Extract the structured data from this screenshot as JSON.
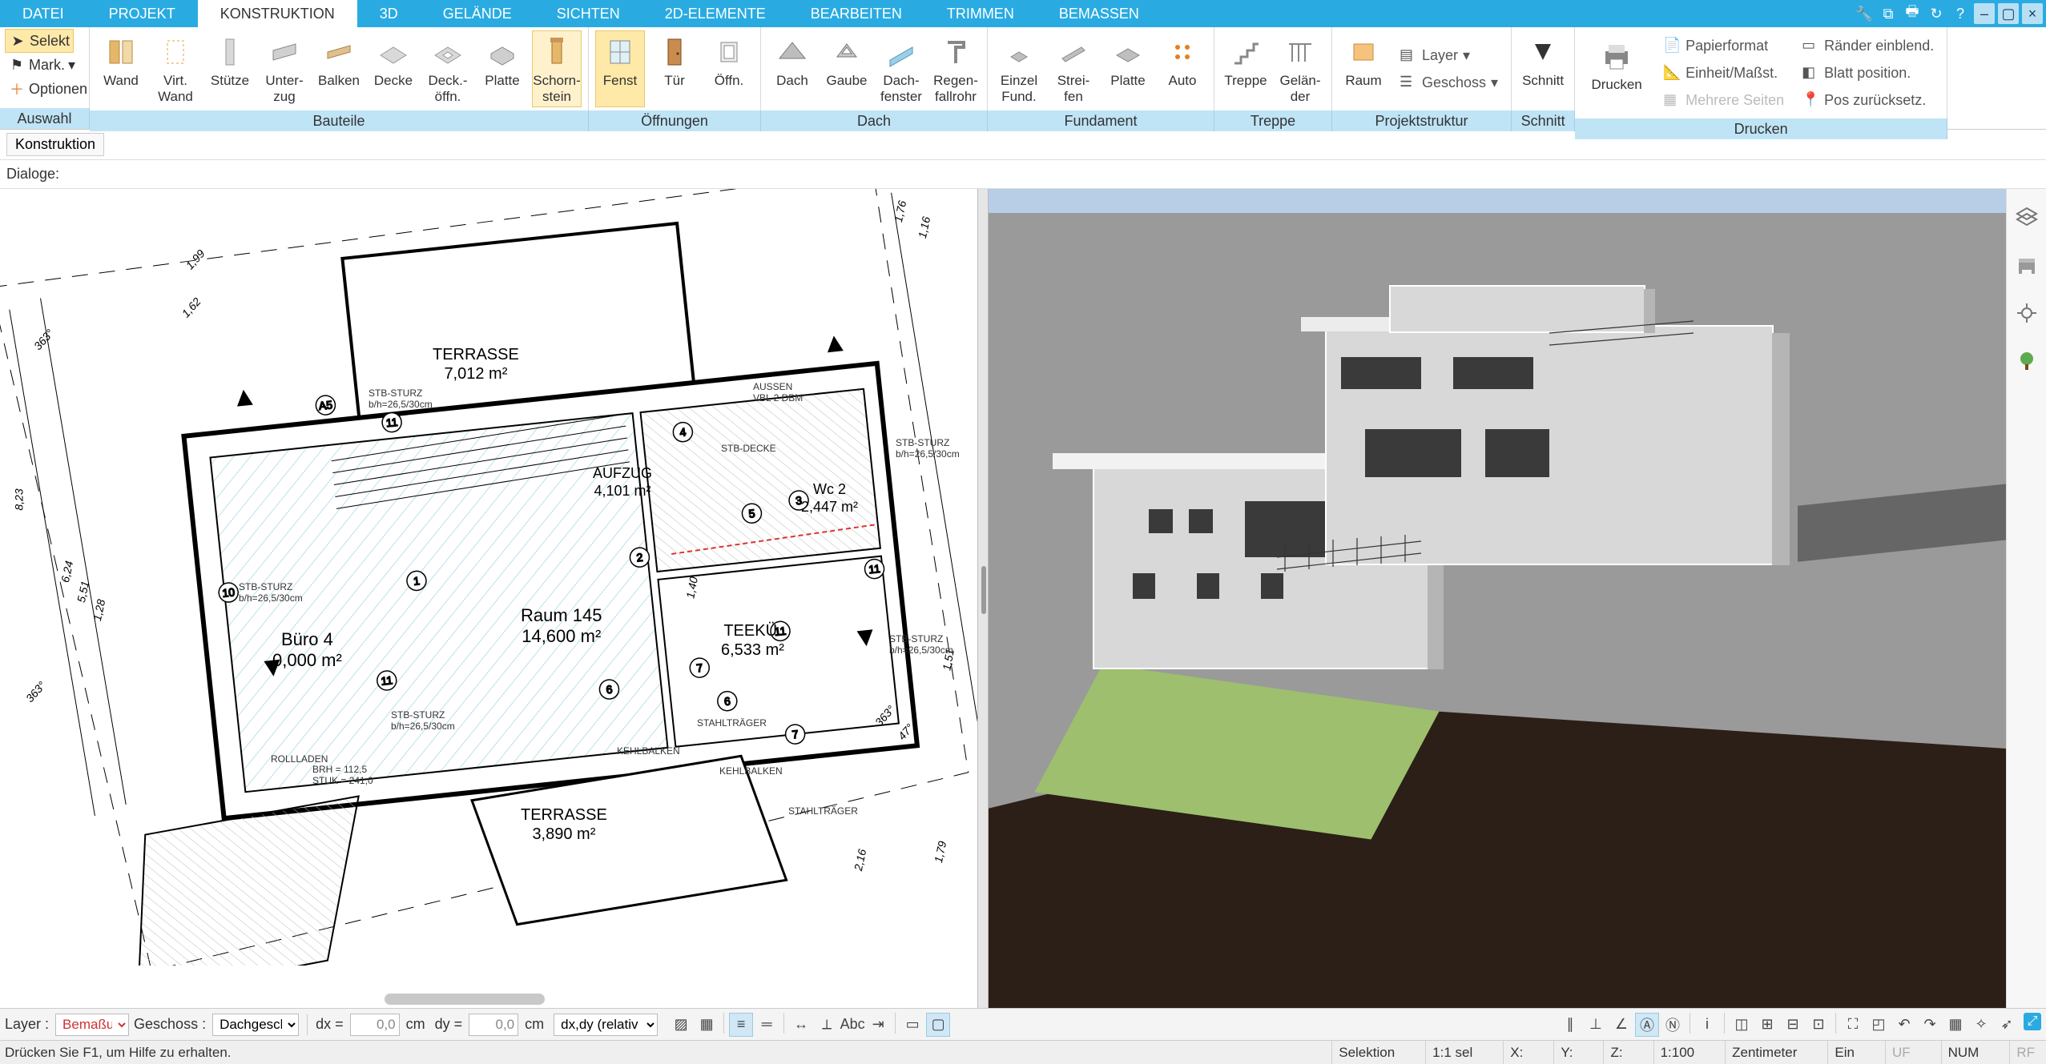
{
  "menu": {
    "tabs": [
      "DATEI",
      "PROJEKT",
      "KONSTRUKTION",
      "3D",
      "GELÄNDE",
      "SICHTEN",
      "2D-ELEMENTE",
      "BEARBEITEN",
      "TRIMMEN",
      "BEMASSEN"
    ],
    "active_index": 2
  },
  "ribbon": {
    "auswahl": {
      "foot": "Auswahl",
      "selekt": "Selekt",
      "mark": "Mark.",
      "optionen": "Optionen"
    },
    "bauteile": {
      "foot": "Bauteile",
      "items": [
        "Wand",
        "Virt.\nWand",
        "Stütze",
        "Unter-\nzug",
        "Balken",
        "Decke",
        "Deck.-\nöffn.",
        "Platte",
        "Schorn-\nstein"
      ]
    },
    "oeffnungen": {
      "foot": "Öffnungen",
      "items": [
        "Fenst",
        "Tür",
        "Öffn."
      ]
    },
    "dach": {
      "foot": "Dach",
      "items": [
        "Dach",
        "Gaube",
        "Dach-\nfenster",
        "Regen-\nfallrohr"
      ]
    },
    "fundament": {
      "foot": "Fundament",
      "items": [
        "Einzel\nFund.",
        "Strei-\nfen",
        "Platte",
        "Auto"
      ]
    },
    "treppe": {
      "foot": "Treppe",
      "items": [
        "Treppe",
        "Gelän-\nder"
      ]
    },
    "projektstruktur": {
      "foot": "Projektstruktur",
      "raum": "Raum",
      "layer": "Layer",
      "geschoss": "Geschoss"
    },
    "schnitt": {
      "foot": "Schnitt",
      "schnitt": "Schnitt"
    },
    "drucken": {
      "foot": "Drucken",
      "drucken": "Drucken",
      "links": [
        "Papierformat",
        "Einheit/Maßst.",
        "Mehrere Seiten",
        "Ränder einblend.",
        "Blatt position.",
        "Pos zurücksetz."
      ]
    }
  },
  "below": {
    "construction": "Konstruktion",
    "dialogs": "Dialoge:"
  },
  "plan": {
    "terrasse1": "TERRASSE",
    "terrasse1_area": "7,012 m²",
    "aufzug": "AUFZUG",
    "aufzug_area": "4,101 m²",
    "wc": "Wc 2",
    "wc_area": "2,447 m²",
    "buero": "Büro 4",
    "buero_area": "0,000 m²",
    "raum": "Raum 145",
    "raum_area": "14,600 m²",
    "teeku": "TEEKÜ.",
    "teeku_area": "6,533 m²",
    "terrasse2": "TERRASSE",
    "terrasse2_area": "3,890 m²",
    "dims": {
      "d199": "1,99",
      "d162": "1,62",
      "d823": "8,23",
      "d624": "6,24",
      "d551": "5,51",
      "d128": "1,28",
      "d363": "363°",
      "d363b": "363°",
      "d176": "1,76",
      "d116": "1,16",
      "d140": "1,40",
      "d151": "1,51",
      "d216": "2,16",
      "d179": "1,79",
      "d363c": "363°",
      "d47": "47°"
    },
    "tags": {
      "stb": "STB-STURZ",
      "bh": "b/h=26,5/30cm",
      "aussen": "AUSSEN",
      "vbl": "VBL 2 DBM",
      "rolll": "ROLLLADEN",
      "stahl": "STAHLTRÄGER",
      "kehl": "KEHLBALKEN",
      "stbd": "STB-DECKE",
      "brh": "BRH = 112,5",
      "stuk": "STUK = 241,0"
    }
  },
  "bottom": {
    "layer_label": "Layer :",
    "layer_value": "Bemaßung",
    "geschoss_label": "Geschoss :",
    "geschoss_value": "Dachgesch",
    "dx": "dx =",
    "dy": "dy =",
    "val": "0,0",
    "cm": "cm",
    "rel": "dx,dy (relativ ka"
  },
  "status": {
    "help": "Drücken Sie F1, um Hilfe zu erhalten.",
    "sel": "Selektion",
    "ratio": "1:1 sel",
    "x": "X:",
    "y": "Y:",
    "z": "Z:",
    "scale": "1:100",
    "unit": "Zentimeter",
    "ein": "Ein",
    "uf": "UF",
    "num": "NUM",
    "rf": "RF"
  }
}
